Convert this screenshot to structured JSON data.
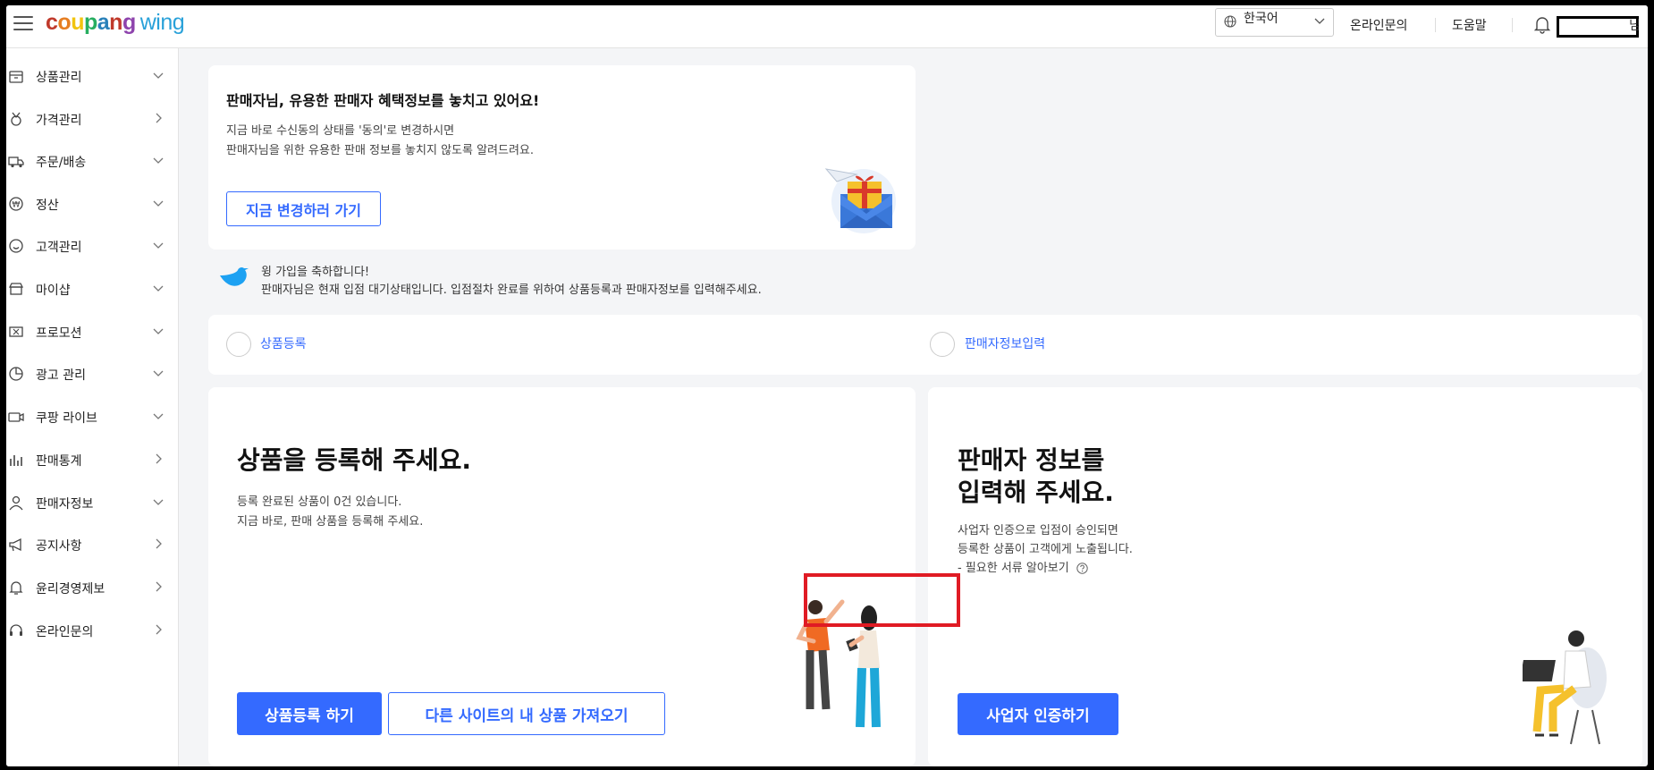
{
  "header": {
    "logo_text": "coupang",
    "logo_sub": "wing",
    "language": "한국어",
    "links": [
      "온라인문의",
      "도움말"
    ],
    "user_suffix": "님"
  },
  "sidebar": {
    "items": [
      {
        "label": "상품관리",
        "icon": "box-icon",
        "chevron": "down"
      },
      {
        "label": "가격관리",
        "icon": "medal-icon",
        "chevron": "right"
      },
      {
        "label": "주문/배송",
        "icon": "truck-icon",
        "chevron": "down"
      },
      {
        "label": "정산",
        "icon": "won-coin-icon",
        "chevron": "down"
      },
      {
        "label": "고객관리",
        "icon": "smile-icon",
        "chevron": "down"
      },
      {
        "label": "마이샵",
        "icon": "shop-icon",
        "chevron": "down"
      },
      {
        "label": "프로모션",
        "icon": "ticket-icon",
        "chevron": "down"
      },
      {
        "label": "광고 관리",
        "icon": "pie-chart-icon",
        "chevron": "down"
      },
      {
        "label": "쿠팡 라이브",
        "icon": "live-camera-icon",
        "chevron": "down"
      },
      {
        "label": "판매통계",
        "icon": "bar-chart-icon",
        "chevron": "right"
      },
      {
        "label": "판매자정보",
        "icon": "person-icon",
        "chevron": "down"
      },
      {
        "label": "공지사항",
        "icon": "megaphone-icon",
        "chevron": "right"
      },
      {
        "label": "윤리경영제보",
        "icon": "bell-outline-icon",
        "chevron": "right"
      },
      {
        "label": "온라인문의",
        "icon": "headset-icon",
        "chevron": "right"
      }
    ]
  },
  "benefit_card": {
    "title": "판매자님, 유용한 판매자 혜택정보를 놓치고 있어요!",
    "line1": "지금 바로 수신동의 상태를 '동의'로 변경하시면",
    "line2": "판매자님을 위한 유용한 판매 정보를 놓치지 않도록 알려드려요.",
    "button": "지금 변경하러 가기"
  },
  "welcome": {
    "line1": "윙 가입을 축하합니다!",
    "line2": "판매자님은 현재 입점 대기상태입니다. 입점절차 완료를 위하여 상품등록과 판매자정보를 입력해주세요."
  },
  "steps": [
    "상품등록",
    "판매자정보입력"
  ],
  "product_card": {
    "title": "상품을 등록해 주세요.",
    "line1": "등록 완료된 상품이 0건 있습니다.",
    "line2": "지금 바로, 판매 상품을 등록해 주세요.",
    "primary_button": "상품등록 하기",
    "secondary_button": "다른 사이트의 내 상품 가져오기"
  },
  "seller_card": {
    "title_line1": "판매자 정보를",
    "title_line2": "입력해 주세요.",
    "line1": "사업자 인증으로 입점이 승인되면",
    "line2": "등록한 상품이 고객에게 노출됩니다.",
    "line3": "- 필요한 서류 알아보기",
    "button": "사업자 인증하기"
  },
  "colors": {
    "primary": "#346aff",
    "highlight": "#e01b24"
  }
}
